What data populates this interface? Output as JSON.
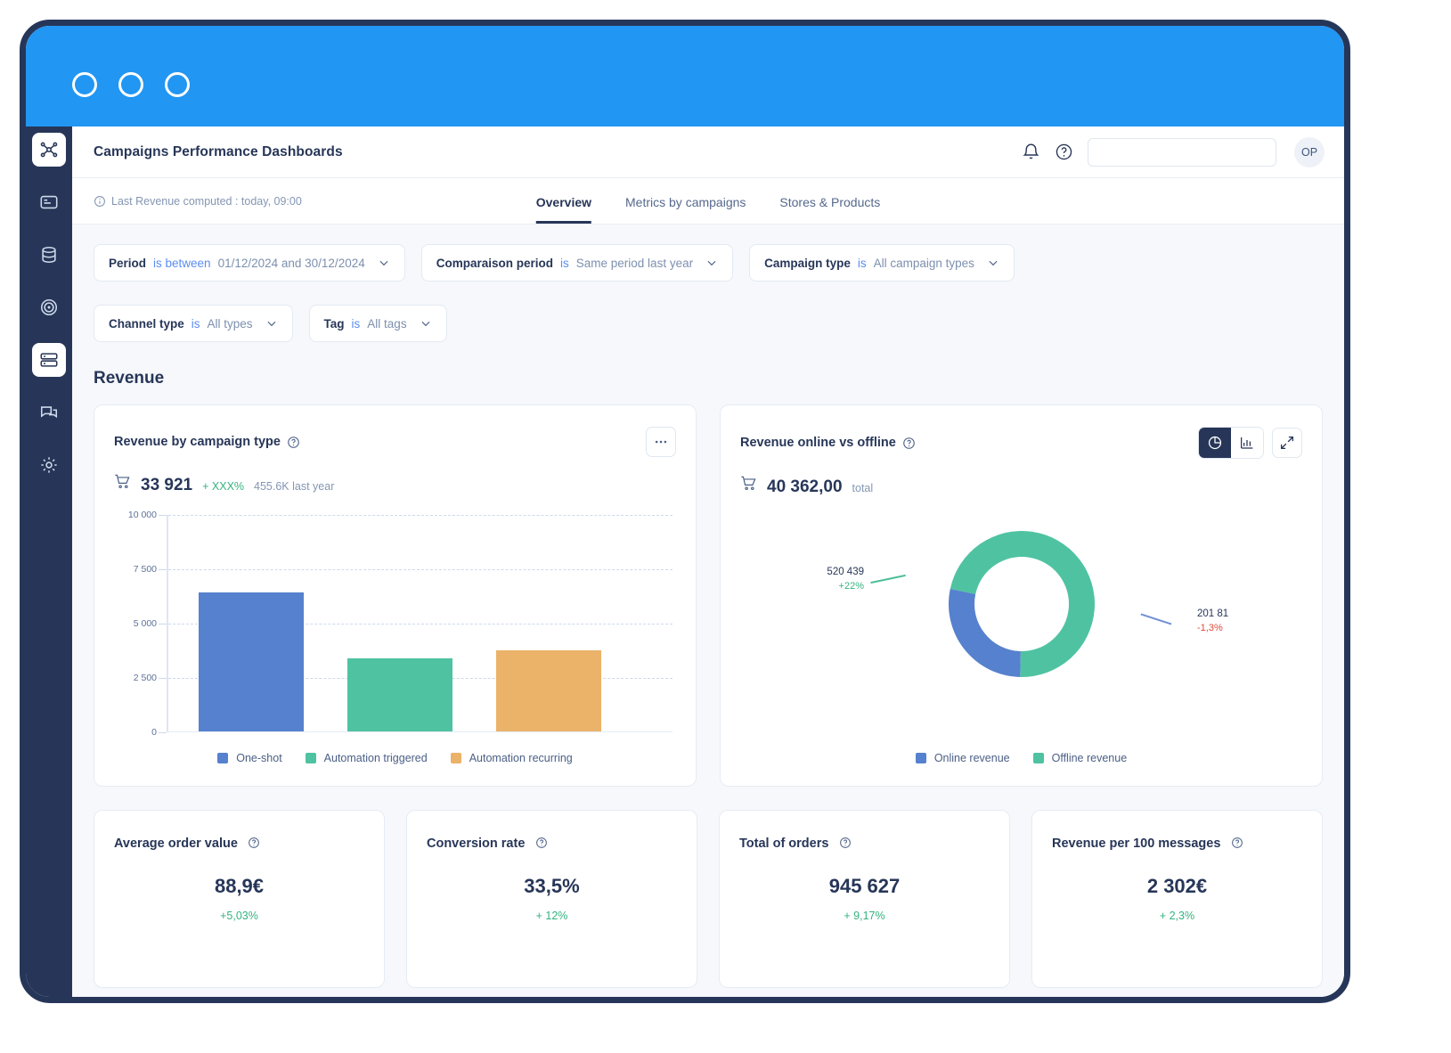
{
  "window": {
    "dots": [
      "close",
      "minimize",
      "maximize"
    ]
  },
  "header": {
    "title": "Campaigns Performance Dashboards",
    "search_value": "",
    "search_placeholder": "",
    "avatar_initials": "OP",
    "bell_icon": "bell-icon",
    "help_icon": "question-circle-icon"
  },
  "statusbar": {
    "last_computed": "Last Revenue computed : today, 09:00"
  },
  "tabs": [
    {
      "label": "Overview",
      "active": true
    },
    {
      "label": "Metrics by campaigns",
      "active": false
    },
    {
      "label": "Stores & Products",
      "active": false
    }
  ],
  "filters": [
    {
      "label": "Period",
      "op": "is between",
      "value": "01/12/2024  and  30/12/2024"
    },
    {
      "label": "Comparaison period",
      "op": "is",
      "value": "Same period last year"
    },
    {
      "label": "Campaign type",
      "op": "is",
      "value": "All campaign types"
    },
    {
      "label": "Channel type",
      "op": "is",
      "value": "All types"
    },
    {
      "label": "Tag",
      "op": "is",
      "value": "All tags"
    }
  ],
  "section": {
    "title": "Revenue"
  },
  "cards": {
    "bar_card": {
      "title": "Revenue by campaign type",
      "kpi_value": "33 921",
      "kpi_delta": "+ XXX%",
      "kpi_sub": "455.6K last year",
      "more_label": "…"
    },
    "donut_card": {
      "title": "Revenue online vs offline",
      "kpi_value": "40 362,00",
      "kpi_sub": "total",
      "view_pie": "pie-chart-icon",
      "view_bar": "bar-chart-icon",
      "expand": "expand-icon"
    }
  },
  "kpi_cards": [
    {
      "title": "Average order value",
      "value": "88,9€",
      "delta": "+5,03%"
    },
    {
      "title": "Conversion rate",
      "value": "33,5%",
      "delta": "+ 12%"
    },
    {
      "title": "Total of orders",
      "value": "945 627",
      "delta": "+ 9,17%"
    },
    {
      "title": "Revenue per 100 messages",
      "value": "2 302€",
      "delta": "+ 2,3%"
    }
  ],
  "colors": {
    "brand_blue": "#2196f3",
    "navy": "#273658",
    "series_blue": "#5681ce",
    "series_green": "#4fc3a1",
    "series_orange": "#ebb269",
    "positive": "#35b37e",
    "negative": "#e2483a"
  },
  "chart_data": [
    {
      "type": "bar",
      "title": "Revenue by campaign type",
      "categories": [
        "One-shot",
        "Automation triggered",
        "Automation recurring"
      ],
      "values": [
        6390,
        3360,
        3740
      ],
      "colors": [
        "#5681ce",
        "#4fc3a1",
        "#ebb269"
      ],
      "ylim": [
        0,
        10000
      ],
      "yticks": [
        0,
        2500,
        5000,
        7500,
        10000
      ],
      "ytick_labels": [
        "0",
        "2 500",
        "5 000",
        "7 500",
        "10 000"
      ],
      "xlabel": "",
      "ylabel": "",
      "grid": true,
      "legend": [
        "One-shot",
        "Automation triggered",
        "Automation recurring"
      ],
      "legend_position": "bottom",
      "total_label": "33 921",
      "comparison": "455.6K last year",
      "delta": "+ XXX%"
    },
    {
      "type": "pie",
      "title": "Revenue online vs offline",
      "subtype": "donut",
      "total": "40 362,00",
      "total_suffix": "total",
      "labels": [
        "Online revenue",
        "Offline revenue"
      ],
      "colors": [
        "#5681ce",
        "#4fc3a1"
      ],
      "slices": [
        {
          "name": "Offline revenue",
          "value_label": "520 439",
          "delta": "+22%",
          "delta_sign": "positive",
          "share_pct": 72,
          "color": "#4fc3a1"
        },
        {
          "name": "Online revenue",
          "value_label": "201 81",
          "delta": "-1,3%",
          "delta_sign": "negative",
          "share_pct": 28,
          "color": "#5681ce"
        }
      ],
      "legend": [
        "Online revenue",
        "Offline revenue"
      ],
      "legend_position": "bottom"
    }
  ]
}
